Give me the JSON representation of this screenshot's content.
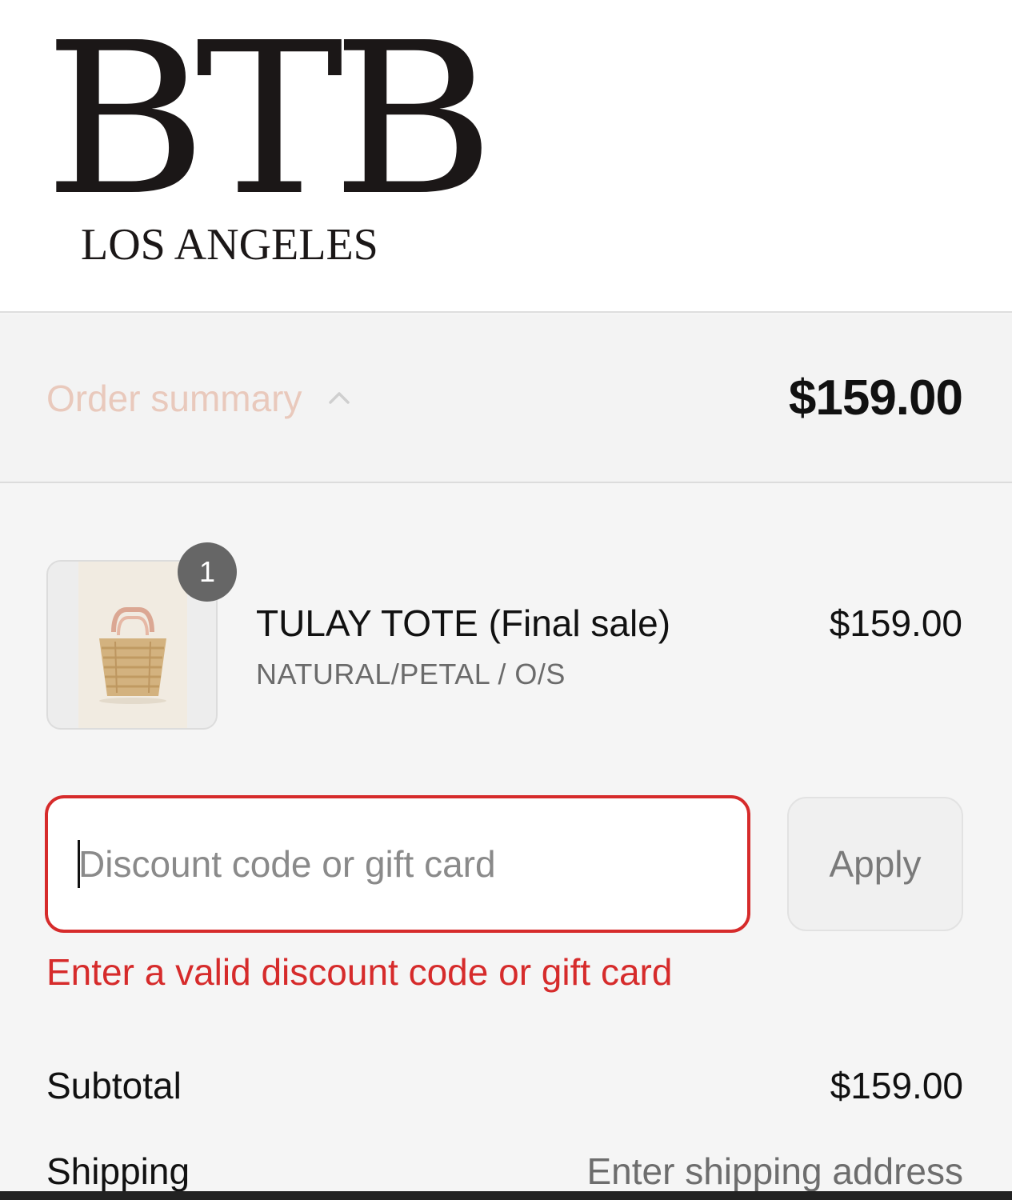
{
  "brand": {
    "name": "BTB",
    "location": "LOS ANGELES"
  },
  "summary": {
    "toggle_label": "Order summary",
    "total": "$159.00"
  },
  "line_items": [
    {
      "name": "TULAY TOTE (Final sale)",
      "variant": "NATURAL/PETAL / O/S",
      "price": "$159.00",
      "quantity": "1",
      "image_icon": "tote-bag-thumbnail"
    }
  ],
  "discount": {
    "placeholder": "Discount code or gift card",
    "value": "",
    "apply_label": "Apply",
    "error": "Enter a valid discount code or gift card"
  },
  "totals": {
    "subtotal_label": "Subtotal",
    "subtotal_value": "$159.00",
    "shipping_label": "Shipping",
    "shipping_value": "Enter shipping address"
  },
  "colors": {
    "accent_muted": "#e9c9bc",
    "error": "#d62b2b"
  }
}
